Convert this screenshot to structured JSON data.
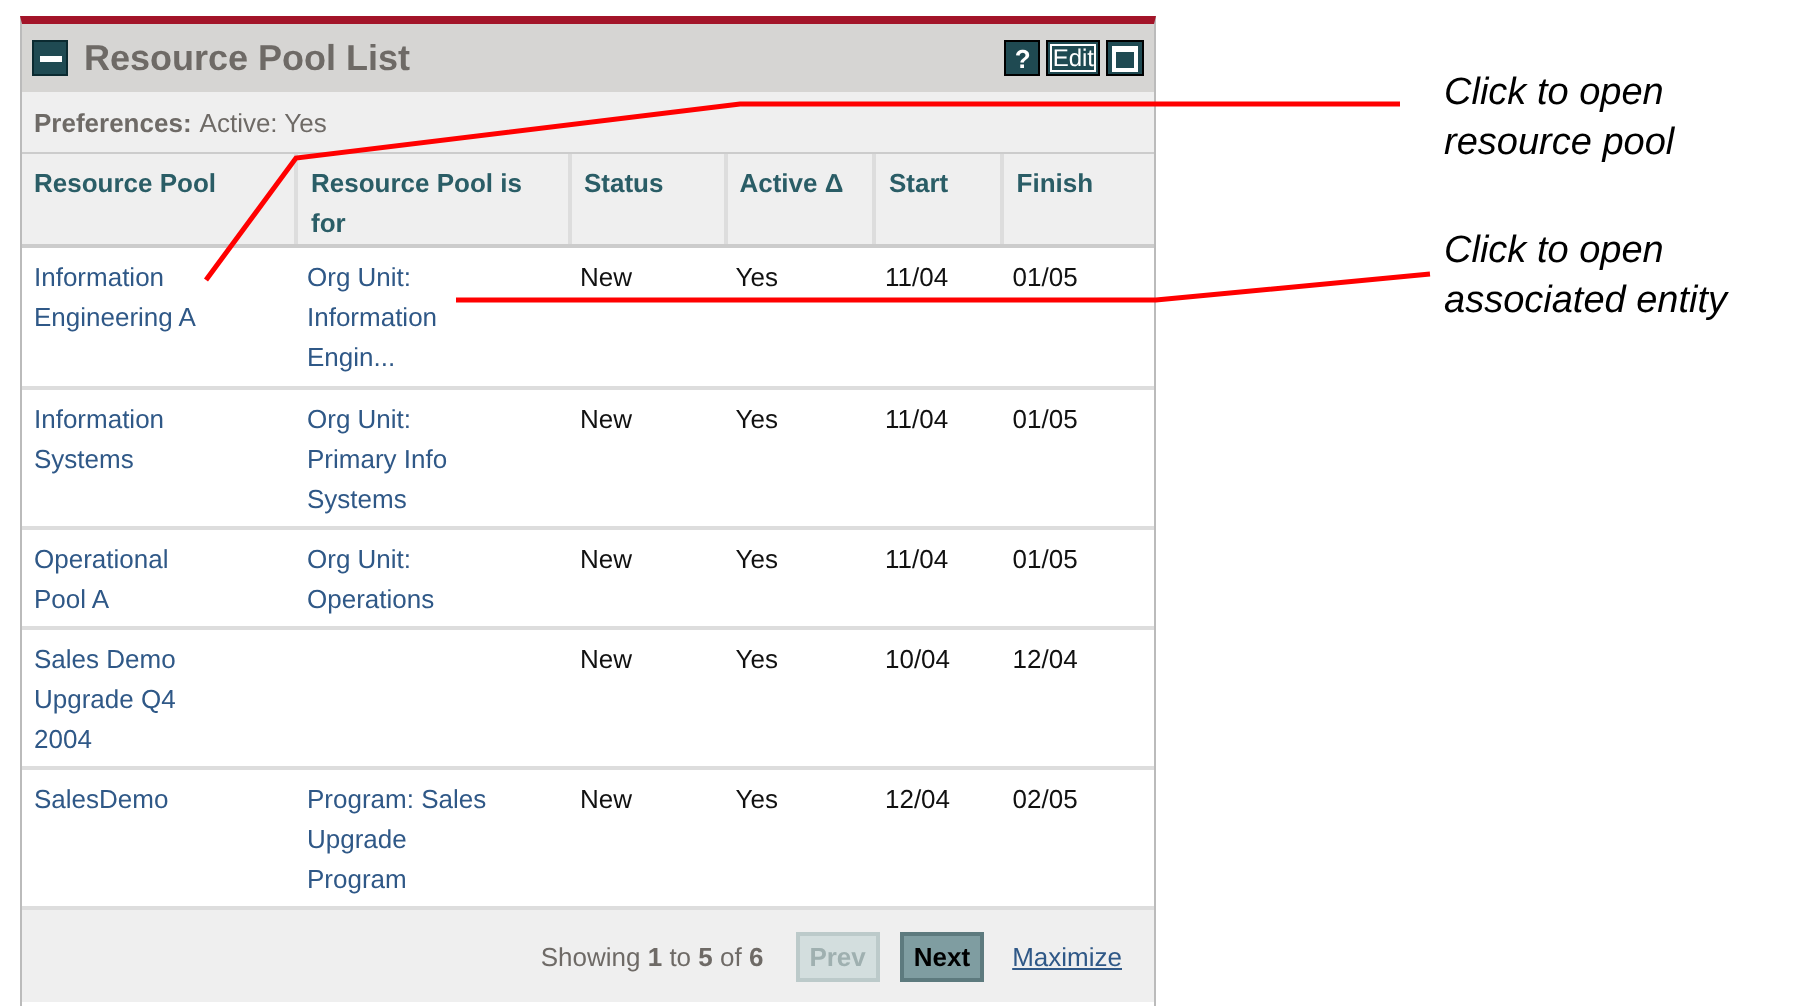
{
  "portlet": {
    "title": "Resource Pool List",
    "header_buttons": [
      {
        "kind": "help",
        "label": "?"
      },
      {
        "kind": "edit",
        "label": "Edit"
      },
      {
        "kind": "maximize"
      }
    ],
    "preferences": {
      "label": "Preferences:",
      "value": "Active: Yes"
    },
    "table": {
      "columns": [
        "Resource Pool",
        "Resource Pool is for",
        "Status",
        "Active Δ",
        "Start",
        "Finish"
      ],
      "rows": [
        {
          "pool": "Information Engineering A",
          "pool_for": "Org Unit: Information Engin...",
          "status": "New",
          "active": "Yes",
          "start": "11/04",
          "finish": "01/05"
        },
        {
          "pool": "Information Systems",
          "pool_for": "Org Unit: Primary Info Systems",
          "status": "New",
          "active": "Yes",
          "start": "11/04",
          "finish": "01/05"
        },
        {
          "pool": "Operational Pool A",
          "pool_for": "Org Unit: Operations",
          "status": "New",
          "active": "Yes",
          "start": "11/04",
          "finish": "01/05"
        },
        {
          "pool": "Sales Demo Upgrade Q4 2004",
          "status": "New",
          "active": "Yes",
          "start": "10/04",
          "finish": "12/04"
        },
        {
          "pool": "SalesDemo",
          "pool_for": "Program: Sales Upgrade Program",
          "status": "New",
          "active": "Yes",
          "start": "12/04",
          "finish": "02/05"
        }
      ]
    },
    "footer": {
      "showing": "Showing **1** to **5** of **6**",
      "buttons": [
        {
          "label": "Prev",
          "disabled": true
        },
        {
          "label": "Next",
          "disabled": false
        }
      ],
      "link": "Maximize"
    }
  },
  "callouts": [
    "Click to open resource pool",
    "Click to open associated entity"
  ]
}
